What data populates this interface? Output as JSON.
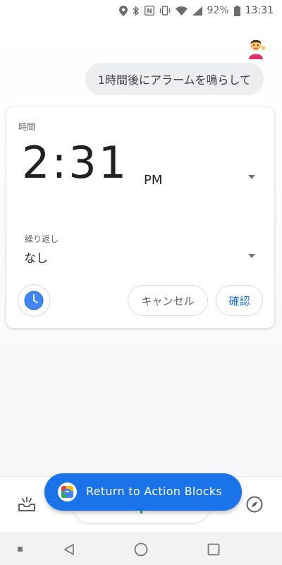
{
  "status_bar": {
    "battery": "92%",
    "time": "13:31",
    "icons": [
      "location-icon",
      "bluetooth-icon",
      "nfc-icon",
      "vibrate-icon",
      "wifi-icon",
      "signal-icon",
      "battery-icon"
    ]
  },
  "conversation": {
    "user_query": "1時間後にアラームを鳴らして"
  },
  "alarm_card": {
    "time_label": "時間",
    "time_value": "2:31",
    "ampm": "PM",
    "repeat_label": "繰り返し",
    "repeat_value": "なし",
    "cancel_label": "キャンセル",
    "confirm_label": "確認",
    "app_icon": "clock-icon"
  },
  "snackbar": {
    "label": "Return to Action Blocks",
    "icon": "action-blocks-icon"
  },
  "bottom_bar": {
    "left_icon": "updates-inbox-icon",
    "right_icon": "explore-compass-icon"
  },
  "nav_bar": {
    "items": [
      "recents-dot",
      "back-button",
      "home-button",
      "overview-button"
    ]
  },
  "colors": {
    "accent": "#1a73e8",
    "bubble": "#eceef0",
    "card_bg": "#ffffff"
  }
}
